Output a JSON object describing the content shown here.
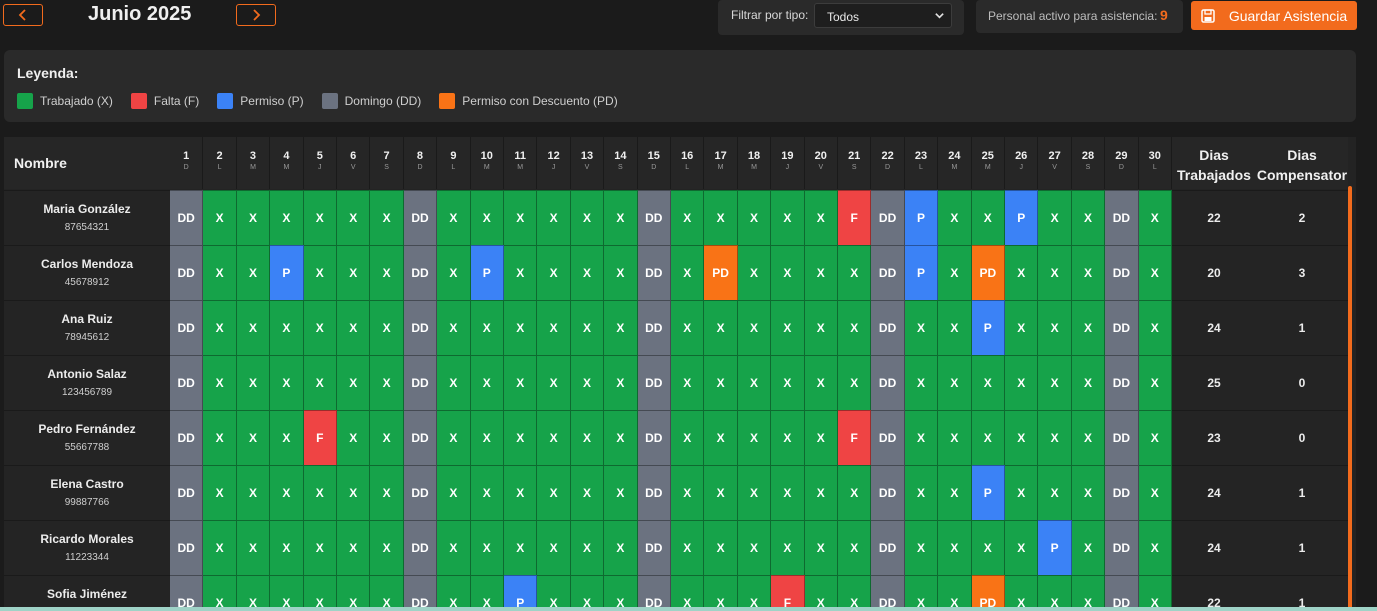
{
  "header": {
    "month_title": "Junio 2025",
    "prev_icon": "chevron-left-icon",
    "next_icon": "chevron-right-icon",
    "filter_label": "Filtrar por tipo:",
    "filter_value": "Todos",
    "active_label": "Personal activo para asistencia:",
    "active_count": "9",
    "save_label": "Guardar Asistencia",
    "save_icon": "save-icon"
  },
  "legend": {
    "title": "Leyenda:",
    "items": [
      {
        "label": "Trabajado (X)",
        "color": "#16a34a"
      },
      {
        "label": "Falta (F)",
        "color": "#ef4444"
      },
      {
        "label": "Permiso (P)",
        "color": "#3b82f6"
      },
      {
        "label": "Domingo (DD)",
        "color": "#6b7280"
      },
      {
        "label": "Permiso con Descuento (PD)",
        "color": "#f97316"
      }
    ]
  },
  "table": {
    "name_header": "Nombre",
    "worked_header_1": "Dias",
    "worked_header_2": "Trabajados",
    "comp_header_1": "Dias",
    "comp_header_2": "Compensator",
    "days": [
      {
        "n": "1",
        "l": "D"
      },
      {
        "n": "2",
        "l": "L"
      },
      {
        "n": "3",
        "l": "M"
      },
      {
        "n": "4",
        "l": "M"
      },
      {
        "n": "5",
        "l": "J"
      },
      {
        "n": "6",
        "l": "V"
      },
      {
        "n": "7",
        "l": "S"
      },
      {
        "n": "8",
        "l": "D"
      },
      {
        "n": "9",
        "l": "L"
      },
      {
        "n": "10",
        "l": "M"
      },
      {
        "n": "11",
        "l": "M"
      },
      {
        "n": "12",
        "l": "J"
      },
      {
        "n": "13",
        "l": "V"
      },
      {
        "n": "14",
        "l": "S"
      },
      {
        "n": "15",
        "l": "D"
      },
      {
        "n": "16",
        "l": "L"
      },
      {
        "n": "17",
        "l": "M"
      },
      {
        "n": "18",
        "l": "M"
      },
      {
        "n": "19",
        "l": "J"
      },
      {
        "n": "20",
        "l": "V"
      },
      {
        "n": "21",
        "l": "S"
      },
      {
        "n": "22",
        "l": "D"
      },
      {
        "n": "23",
        "l": "L"
      },
      {
        "n": "24",
        "l": "M"
      },
      {
        "n": "25",
        "l": "M"
      },
      {
        "n": "26",
        "l": "J"
      },
      {
        "n": "27",
        "l": "V"
      },
      {
        "n": "28",
        "l": "S"
      },
      {
        "n": "29",
        "l": "D"
      },
      {
        "n": "30",
        "l": "L"
      }
    ],
    "employees": [
      {
        "name": "Maria González",
        "id": "87654321",
        "worked": "22",
        "comp": "2",
        "days": [
          "DD",
          "X",
          "X",
          "X",
          "X",
          "X",
          "X",
          "DD",
          "X",
          "X",
          "X",
          "X",
          "X",
          "X",
          "DD",
          "X",
          "X",
          "X",
          "X",
          "X",
          "F",
          "DD",
          "P",
          "X",
          "X",
          "P",
          "X",
          "X",
          "DD",
          "X"
        ]
      },
      {
        "name": "Carlos Mendoza",
        "id": "45678912",
        "worked": "20",
        "comp": "3",
        "days": [
          "DD",
          "X",
          "X",
          "P",
          "X",
          "X",
          "X",
          "DD",
          "X",
          "P",
          "X",
          "X",
          "X",
          "X",
          "DD",
          "X",
          "PD",
          "X",
          "X",
          "X",
          "X",
          "DD",
          "P",
          "X",
          "PD",
          "X",
          "X",
          "X",
          "DD",
          "X"
        ]
      },
      {
        "name": "Ana Ruiz",
        "id": "78945612",
        "worked": "24",
        "comp": "1",
        "days": [
          "DD",
          "X",
          "X",
          "X",
          "X",
          "X",
          "X",
          "DD",
          "X",
          "X",
          "X",
          "X",
          "X",
          "X",
          "DD",
          "X",
          "X",
          "X",
          "X",
          "X",
          "X",
          "DD",
          "X",
          "X",
          "P",
          "X",
          "X",
          "X",
          "DD",
          "X"
        ]
      },
      {
        "name": "Antonio Salaz",
        "id": "123456789",
        "worked": "25",
        "comp": "0",
        "days": [
          "DD",
          "X",
          "X",
          "X",
          "X",
          "X",
          "X",
          "DD",
          "X",
          "X",
          "X",
          "X",
          "X",
          "X",
          "DD",
          "X",
          "X",
          "X",
          "X",
          "X",
          "X",
          "DD",
          "X",
          "X",
          "X",
          "X",
          "X",
          "X",
          "DD",
          "X"
        ]
      },
      {
        "name": "Pedro Fernández",
        "id": "55667788",
        "worked": "23",
        "comp": "0",
        "days": [
          "DD",
          "X",
          "X",
          "X",
          "F",
          "X",
          "X",
          "DD",
          "X",
          "X",
          "X",
          "X",
          "X",
          "X",
          "DD",
          "X",
          "X",
          "X",
          "X",
          "X",
          "F",
          "DD",
          "X",
          "X",
          "X",
          "X",
          "X",
          "X",
          "DD",
          "X"
        ]
      },
      {
        "name": "Elena Castro",
        "id": "99887766",
        "worked": "24",
        "comp": "1",
        "days": [
          "DD",
          "X",
          "X",
          "X",
          "X",
          "X",
          "X",
          "DD",
          "X",
          "X",
          "X",
          "X",
          "X",
          "X",
          "DD",
          "X",
          "X",
          "X",
          "X",
          "X",
          "X",
          "DD",
          "X",
          "X",
          "P",
          "X",
          "X",
          "X",
          "DD",
          "X"
        ]
      },
      {
        "name": "Ricardo Morales",
        "id": "11223344",
        "worked": "24",
        "comp": "1",
        "days": [
          "DD",
          "X",
          "X",
          "X",
          "X",
          "X",
          "X",
          "DD",
          "X",
          "X",
          "X",
          "X",
          "X",
          "X",
          "DD",
          "X",
          "X",
          "X",
          "X",
          "X",
          "X",
          "DD",
          "X",
          "X",
          "X",
          "X",
          "P",
          "X",
          "DD",
          "X"
        ]
      },
      {
        "name": "Sofia Jiménez",
        "id": "",
        "worked": "22",
        "comp": "1",
        "days": [
          "DD",
          "X",
          "X",
          "X",
          "X",
          "X",
          "X",
          "DD",
          "X",
          "X",
          "P",
          "X",
          "X",
          "X",
          "DD",
          "X",
          "X",
          "X",
          "F",
          "X",
          "X",
          "DD",
          "X",
          "X",
          "PD",
          "X",
          "X",
          "X",
          "DD",
          "X"
        ]
      }
    ]
  }
}
